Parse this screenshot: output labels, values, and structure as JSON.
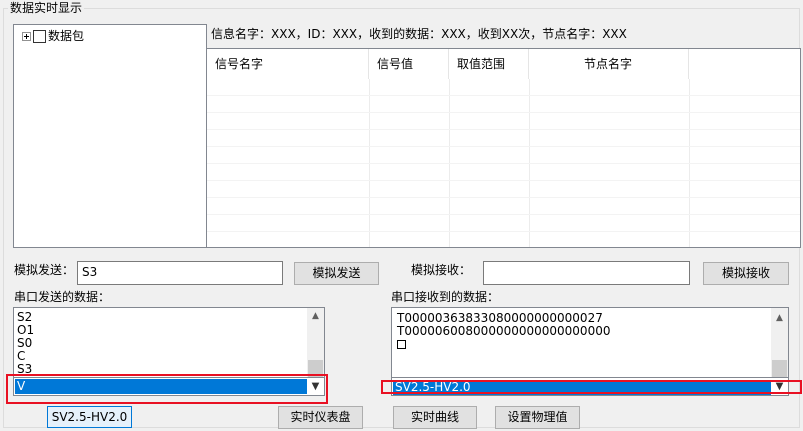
{
  "group": {
    "title": "数据实时显示"
  },
  "tree": {
    "root_label": "数据包"
  },
  "info_line": "信息名字：XXX，ID：XXX，收到的数据：XXX，收到XX次，节点名字：XXX",
  "table": {
    "columns": [
      "信号名字",
      "信号值",
      "取值范围",
      "节点名字"
    ]
  },
  "sim_send": {
    "label": "模拟发送：",
    "value": "S3",
    "button": "模拟发送"
  },
  "sim_recv": {
    "label": "模拟接收：",
    "value": "",
    "button": "模拟接收"
  },
  "serial_sent": {
    "label": "串口发送的数据：",
    "items": [
      "S2",
      "O1",
      "S0",
      "C",
      "S3"
    ],
    "selected": "V"
  },
  "serial_recv": {
    "label": "串口接收到的数据：",
    "items": [
      "T00000363833080000000000027",
      "T000006008000000000000000000"
    ],
    "selected": "SV2.5-HV2.0"
  },
  "bottom": {
    "version_button": "SV2.5-HV2.0",
    "dashboard_button": "实时仪表盘",
    "curve_button": "实时曲线",
    "physical_button": "设置物理值"
  },
  "colors": {
    "selection": "#0078d7",
    "highlight_box": "#e81123"
  }
}
